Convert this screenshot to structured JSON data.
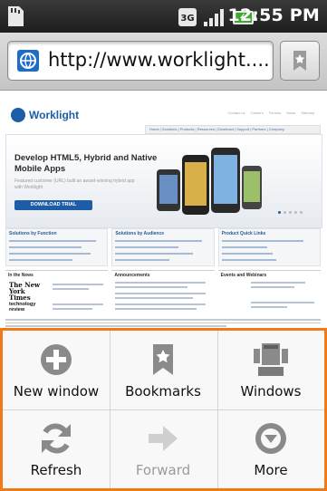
{
  "status_bar": {
    "time": "12:55 PM"
  },
  "url_bar": {
    "url": "http://www.worklight...."
  },
  "webpage": {
    "logo_text": "Worklight",
    "top_nav": [
      "Contact us",
      "Careers",
      "Forums",
      "News",
      "Sitemap"
    ],
    "sub_nav": "Home | Solutions | Products | Resources | Download | Support | Partners | Company",
    "hero_title": "Develop HTML5, Hybrid and Native Mobile Apps",
    "hero_subtitle": "Featured customer (URL) built an award-winning hybrid app with Worklight",
    "trial_button": "DOWNLOAD TRIAL",
    "sections": [
      "Solutions by Function",
      "Solutions by Audience",
      "Product Quick Links"
    ],
    "news_sections": [
      "In the News",
      "Announcements",
      "Events and Webinars"
    ],
    "press_logos": [
      "The New York Times",
      "technology review"
    ]
  },
  "menu": {
    "items": [
      {
        "label": "New window",
        "icon": "plus-circle-icon",
        "enabled": true
      },
      {
        "label": "Bookmarks",
        "icon": "bookmark-star-icon",
        "enabled": true
      },
      {
        "label": "Windows",
        "icon": "windows-icon",
        "enabled": true
      },
      {
        "label": "Refresh",
        "icon": "refresh-icon",
        "enabled": true
      },
      {
        "label": "Forward",
        "icon": "forward-arrow-icon",
        "enabled": false
      },
      {
        "label": "More",
        "icon": "chevron-down-circle-icon",
        "enabled": true
      }
    ]
  },
  "colors": {
    "menu_border": "#f07a1a",
    "brand": "#1d5ca6",
    "status_bar": "#1e1e1e"
  }
}
